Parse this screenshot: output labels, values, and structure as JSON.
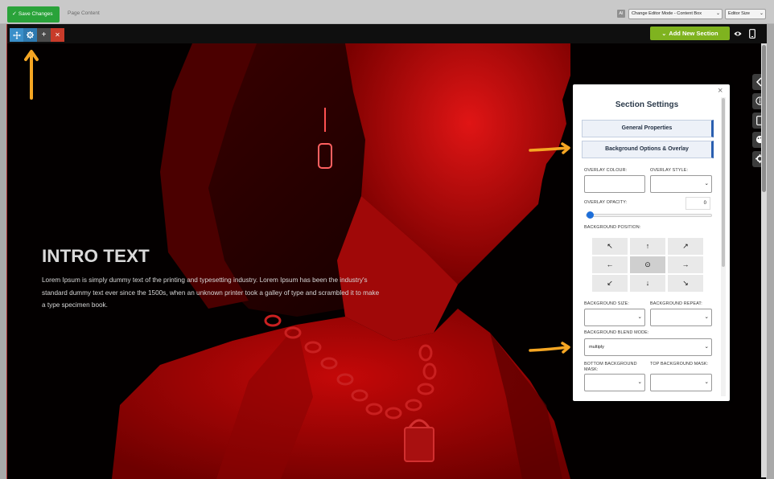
{
  "topbar": {
    "save_label": "Save Changes",
    "page_label": "Page Content",
    "ai_badge": "AI",
    "editor_mode": "Change Editor Mode - Content Box",
    "editor_size": "Editor Size"
  },
  "toolbar": {
    "add_section_label": "Add New Section"
  },
  "hero": {
    "title": "INTRO TEXT",
    "body": "Lorem Ipsum is simply dummy text of the printing and typesetting industry. Lorem Ipsum has been the industry's standard dummy text ever since the 1500s, when an unknown printer took a galley of type and scrambled it to make a type specimen book."
  },
  "panel": {
    "title": "Section Settings",
    "general_label": "General Properties",
    "background_label": "Background Options & Overlay",
    "overlay_colour_label": "OVERLAY COLOUR:",
    "overlay_style_label": "OVERLAY STYLE:",
    "overlay_style_value": "",
    "overlay_opacity_label": "OVERLAY OPACITY:",
    "overlay_opacity_value": "0",
    "bg_position_label": "BACKGROUND POSITION:",
    "bg_size_label": "BACKGROUND SIZE:",
    "bg_size_value": "",
    "bg_repeat_label": "BACKGROUND REPEAT:",
    "bg_repeat_value": "",
    "blend_mode_label": "BACKGROUND BLEND MODE:",
    "blend_mode_value": "multiply",
    "bottom_mask_label": "BOTTOM BACKGROUND MASK:",
    "bottom_mask_value": "",
    "top_mask_label": "TOP BACKGROUND MASK:",
    "top_mask_value": ""
  },
  "colors": {
    "save_green": "#2aa33a",
    "add_section_green": "#7fb31f",
    "accordion_accent": "#2a5fb0",
    "annotation_arrow": "#f5a623",
    "hero_red": "#b00000"
  }
}
